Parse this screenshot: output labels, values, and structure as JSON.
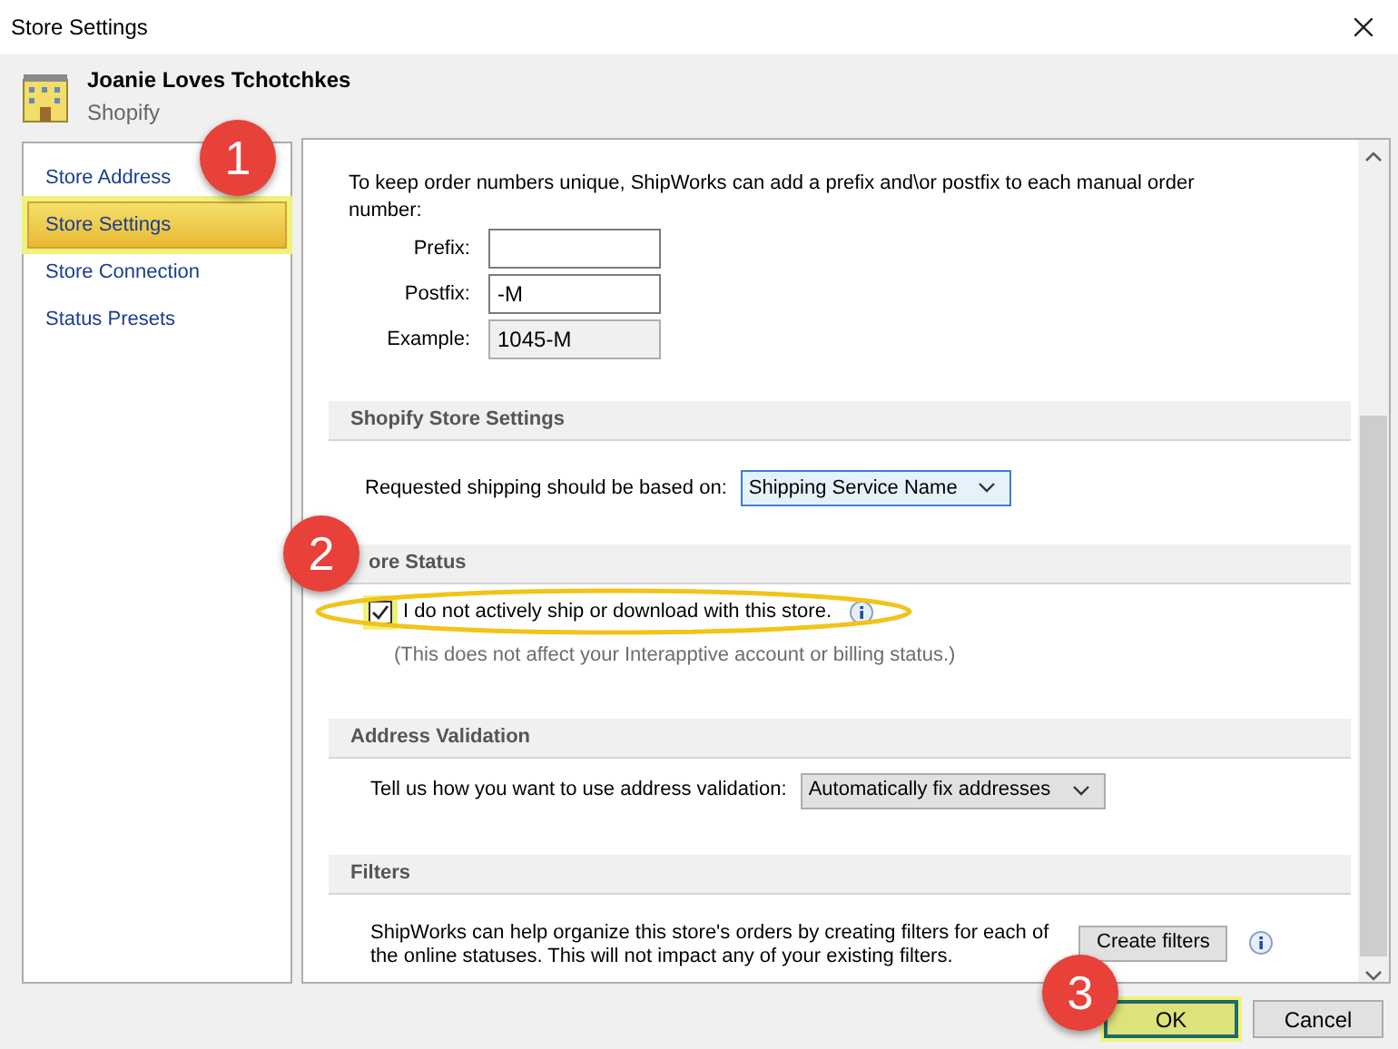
{
  "window": {
    "title": "Store Settings"
  },
  "store": {
    "name": "Joanie Loves Tchotchkes",
    "platform": "Shopify"
  },
  "sidebar": {
    "items": [
      {
        "label": "Store Address",
        "selected": false
      },
      {
        "label": "Store Settings",
        "selected": true
      },
      {
        "label": "Store Connection",
        "selected": false
      },
      {
        "label": "Status Presets",
        "selected": false
      }
    ]
  },
  "order_numbers": {
    "intro": "To keep order numbers unique, ShipWorks can add a prefix and\\or postfix to each manual order number:",
    "fields": [
      {
        "label": "Prefix:",
        "disabled": false
      },
      {
        "label": "Postfix:",
        "value": "-M",
        "disabled": false
      },
      {
        "label": "Example:",
        "value": "1045-M",
        "disabled": true
      }
    ]
  },
  "sections": [
    {
      "title": "Shopify Store Settings",
      "kind": "dropdown",
      "label": "Requested shipping should be based on:",
      "value": "Shipping Service Name",
      "focused": true
    },
    {
      "title": "ore Status",
      "kind": "checkbox",
      "label": "I do not actively ship or download with this store.",
      "checked": true,
      "note": "(This does not affect your Interapptive account or billing status.)"
    },
    {
      "title": "Address Validation",
      "kind": "dropdown",
      "label": "Tell us how you want to use address validation:",
      "value": "Automatically fix addresses",
      "focused": false
    },
    {
      "title": "Filters",
      "kind": "action",
      "text": "ShipWorks can help organize this store's orders by creating filters for each of the online statuses. This will not impact any of your existing filters.",
      "button": "Create filters"
    }
  ],
  "buttons": [
    {
      "label": "OK",
      "highlighted": true
    },
    {
      "label": "Cancel",
      "highlighted": false
    }
  ],
  "callouts": [
    "1",
    "2",
    "3"
  ]
}
